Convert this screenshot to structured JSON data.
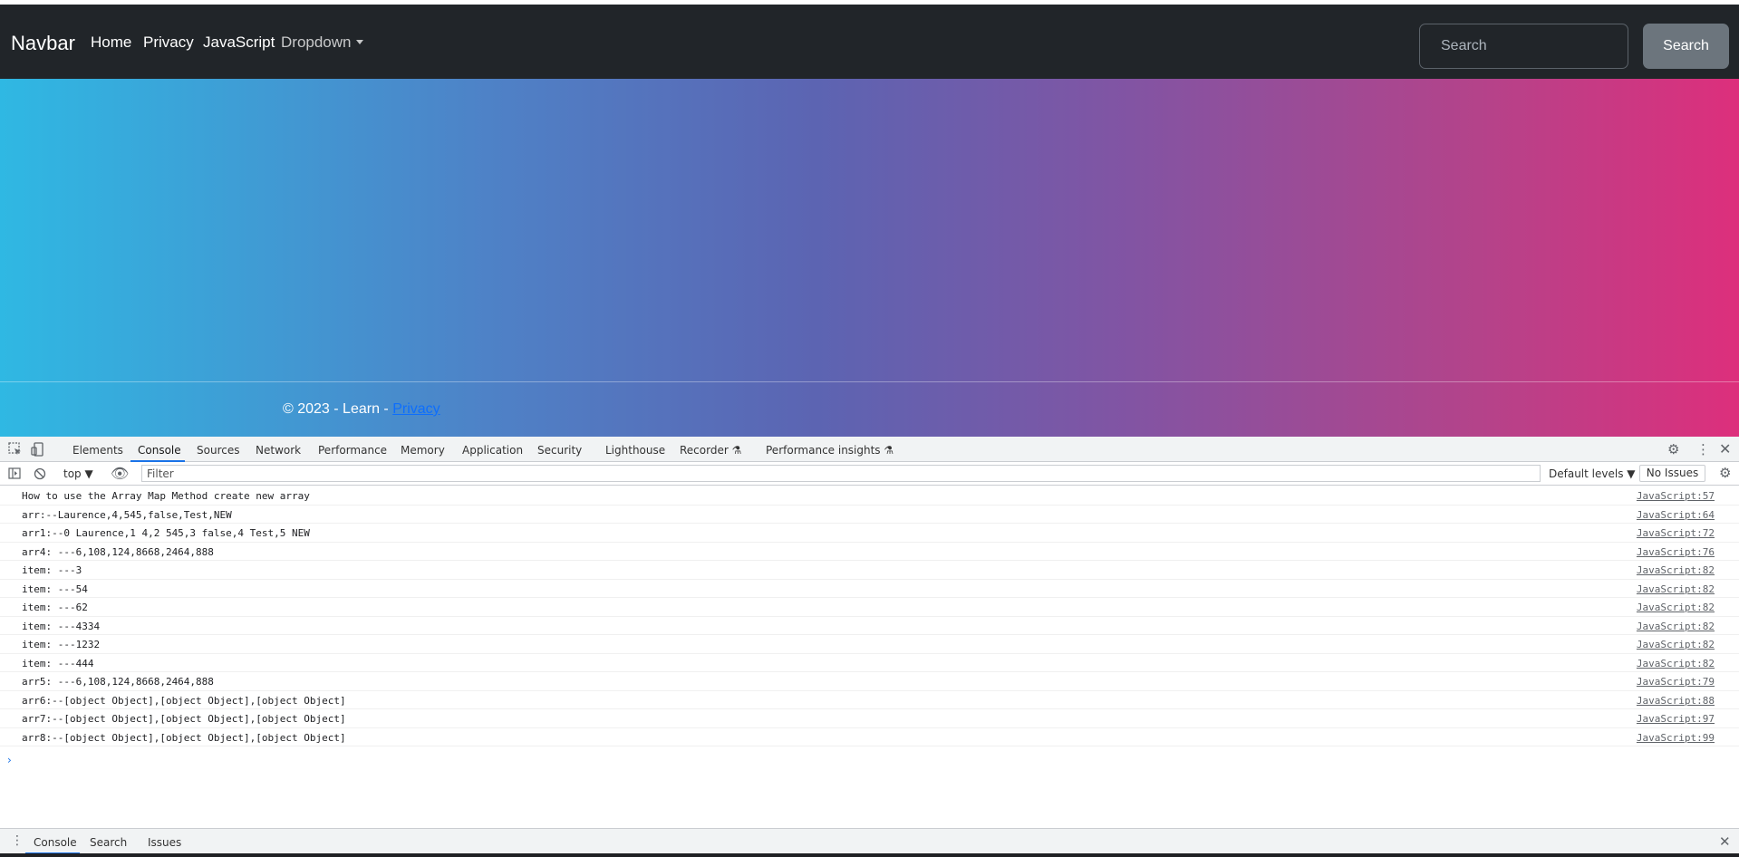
{
  "navbar": {
    "brand": "Navbar",
    "links": [
      "Home",
      "Privacy",
      "JavaScript"
    ],
    "dropdown_label": "Dropdown",
    "search_placeholder": "Search",
    "search_button": "Search"
  },
  "footer": {
    "text": "© 2023 - Learn - ",
    "link": "Privacy"
  },
  "devtools": {
    "tabs": [
      "Elements",
      "Console",
      "Sources",
      "Network",
      "Performance",
      "Memory",
      "Application",
      "Security",
      "Lighthouse",
      "Recorder",
      "Performance insights"
    ],
    "active_tab": "Console",
    "context": "top",
    "filter_placeholder": "Filter",
    "levels": "Default levels",
    "issues": "No Issues",
    "console_rows": [
      {
        "msg": "How to use the Array Map Method create new array",
        "src": "JavaScript:57"
      },
      {
        "msg": "arr:--Laurence,4,545,false,Test,NEW",
        "src": "JavaScript:64"
      },
      {
        "msg": "arr1:--0 Laurence,1 4,2 545,3 false,4 Test,5 NEW",
        "src": "JavaScript:72"
      },
      {
        "msg": "arr4: ---6,108,124,8668,2464,888",
        "src": "JavaScript:76"
      },
      {
        "msg": "item: ---3",
        "src": "JavaScript:82"
      },
      {
        "msg": "item: ---54",
        "src": "JavaScript:82"
      },
      {
        "msg": "item: ---62",
        "src": "JavaScript:82"
      },
      {
        "msg": "item: ---4334",
        "src": "JavaScript:82"
      },
      {
        "msg": "item: ---1232",
        "src": "JavaScript:82"
      },
      {
        "msg": "item: ---444",
        "src": "JavaScript:82"
      },
      {
        "msg": "arr5: ---6,108,124,8668,2464,888",
        "src": "JavaScript:79"
      },
      {
        "msg": "arr6:--[object Object],[object Object],[object Object]",
        "src": "JavaScript:88"
      },
      {
        "msg": "arr7:--[object Object],[object Object],[object Object]",
        "src": "JavaScript:97"
      },
      {
        "msg": "arr8:--[object Object],[object Object],[object Object]",
        "src": "JavaScript:99"
      }
    ],
    "drawer_tabs": [
      "Console",
      "Search",
      "Issues"
    ]
  }
}
